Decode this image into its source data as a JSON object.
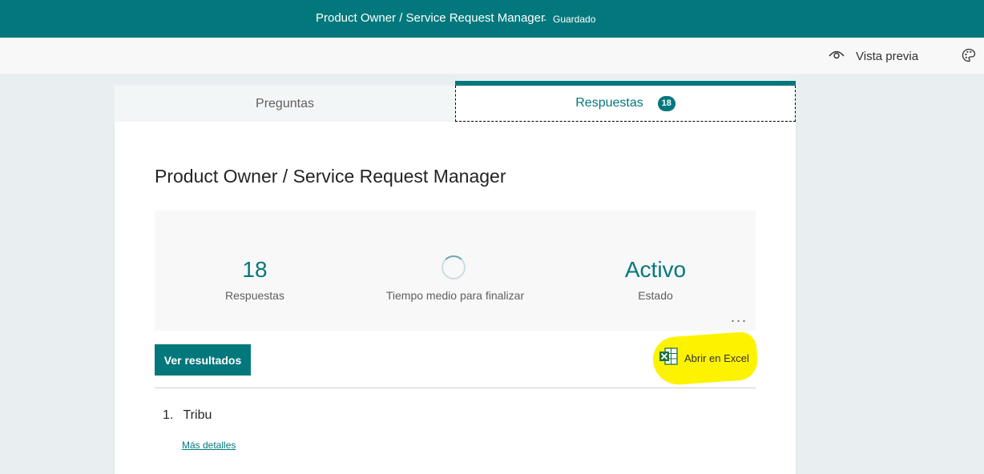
{
  "header": {
    "title": "Product Owner / Service Request Manager",
    "separator": "-",
    "status": "Guardado"
  },
  "toolbar": {
    "preview_label": "Vista previa",
    "preview_icon": "eye-icon",
    "theme_icon": "palette-icon"
  },
  "tabs": [
    {
      "label": "Preguntas",
      "active": false
    },
    {
      "label": "Respuestas",
      "active": true,
      "badge": "18"
    }
  ],
  "form": {
    "title": "Product Owner / Service Request Manager"
  },
  "summary": {
    "responses": {
      "value": "18",
      "caption": "Respuestas"
    },
    "avg_time": {
      "caption": "Tiempo medio para finalizar"
    },
    "state": {
      "value": "Activo",
      "caption": "Estado"
    },
    "more_label": "..."
  },
  "actions": {
    "view_results": "Ver resultados",
    "open_excel": "Abrir en Excel",
    "excel_icon": "excel-icon"
  },
  "questions": [
    {
      "number": "1.",
      "title": "Tribu",
      "details_label": "Más detalles"
    }
  ],
  "colors": {
    "accent": "#03787c",
    "highlight": "#fdf200",
    "background": "#e9eff1"
  }
}
